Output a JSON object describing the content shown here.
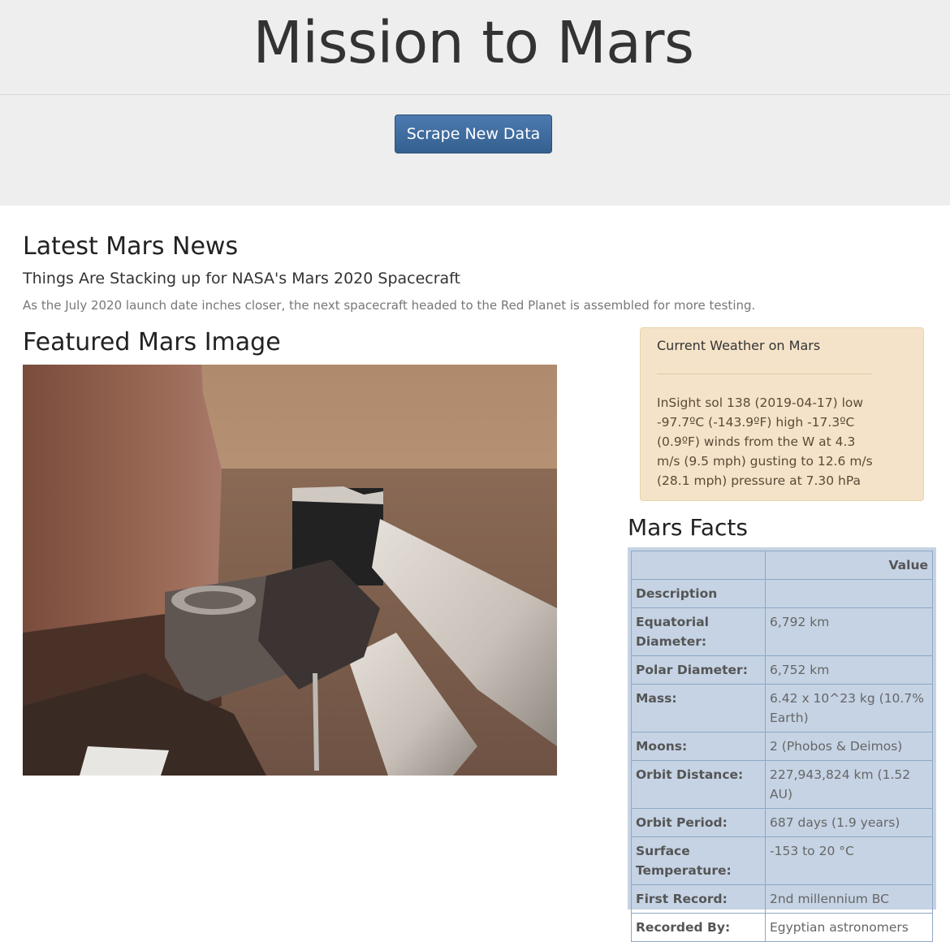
{
  "header": {
    "title": "Mission to Mars",
    "scrape_button_label": "Scrape New Data"
  },
  "news": {
    "heading": "Latest Mars News",
    "title": "Things Are Stacking up for NASA's Mars 2020 Spacecraft",
    "teaser": "As the July 2020 launch date inches closer, the next spacecraft headed to the Red Planet is assembled for more testing."
  },
  "featured": {
    "heading": "Featured Mars Image"
  },
  "weather": {
    "title": "Current Weather on Mars",
    "text": "InSight sol 138 (2019-04-17) low -97.7ºC (-143.9ºF) high -17.3ºC (0.9ºF) winds from the W at 4.3 m/s (9.5 mph) gusting to 12.6 m/s (28.1 mph) pressure at 7.30 hPa",
    "background_color": "#f5e3c9"
  },
  "facts": {
    "heading": "Mars Facts",
    "columns": [
      "",
      "Value"
    ],
    "rows": [
      {
        "label": "Description",
        "value": ""
      },
      {
        "label": "Equatorial Diameter:",
        "value": "6,792 km"
      },
      {
        "label": "Polar Diameter:",
        "value": "6,752 km"
      },
      {
        "label": "Mass:",
        "value": "6.42 x 10^23 kg (10.7% Earth)"
      },
      {
        "label": "Moons:",
        "value": "2 (Phobos & Deimos)"
      },
      {
        "label": "Orbit Distance:",
        "value": "227,943,824 km (1.52 AU)"
      },
      {
        "label": "Orbit Period:",
        "value": "687 days (1.9 years)"
      },
      {
        "label": "Surface Temperature:",
        "value": "-153 to 20 °C"
      },
      {
        "label": "First Record:",
        "value": "2nd millennium BC"
      },
      {
        "label": "Recorded By:",
        "value": "Egyptian astronomers"
      }
    ],
    "background_color": "#c5d3e4"
  },
  "colors": {
    "jumbotron_bg": "#eeeeee",
    "button_bg": "#3e6ca1"
  }
}
